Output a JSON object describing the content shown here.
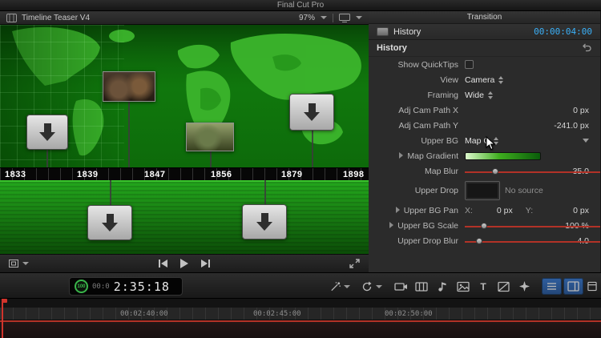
{
  "window": {
    "title": "Final Cut Pro"
  },
  "viewer": {
    "title": "Timeline Teaser V4",
    "zoom": "97%",
    "years": [
      "1833",
      "1839",
      "1847",
      "1856",
      "1879",
      "1898"
    ]
  },
  "inspector": {
    "tab": "Transition",
    "header": {
      "title": "History",
      "timecode": "00:00:04:00"
    },
    "section_title": "History",
    "rows": {
      "quicktips": {
        "label": "Show QuickTips"
      },
      "view": {
        "label": "View",
        "value": "Camera"
      },
      "framing": {
        "label": "Framing",
        "value": "Wide"
      },
      "adj_cam_x": {
        "label": "Adj Cam Path X",
        "value": "0 px"
      },
      "adj_cam_y": {
        "label": "Adj Cam Path Y",
        "value": "-241.0 px"
      },
      "upper_bg": {
        "label": "Upper BG",
        "value": "Map C"
      },
      "map_gradient": {
        "label": "Map Gradient"
      },
      "map_blur": {
        "label": "Map Blur",
        "value": "35.0"
      },
      "upper_drop": {
        "label": "Upper Drop",
        "value": "No source"
      },
      "upper_bg_pan": {
        "label": "Upper BG Pan",
        "x_label": "X:",
        "x_value": "0 px",
        "y_label": "Y:",
        "y_value": "0 px"
      },
      "upper_bg_scale": {
        "label": "Upper BG Scale",
        "value": "100 %"
      },
      "upper_drop_blur": {
        "label": "Upper Drop Blur",
        "value": "4.0"
      }
    }
  },
  "toolbar": {
    "gauge": "100",
    "timecode_prefix": "00:0",
    "timecode": "2:35:18",
    "titles_glyph": "T"
  },
  "timeline": {
    "ruler": [
      "00:02:40:00",
      "00:02:45:00",
      "00:02:50:00"
    ]
  },
  "colors": {
    "accent_blue": "#3ab0f8",
    "map_green": "#2fae24",
    "playhead_red": "#c0392b"
  }
}
